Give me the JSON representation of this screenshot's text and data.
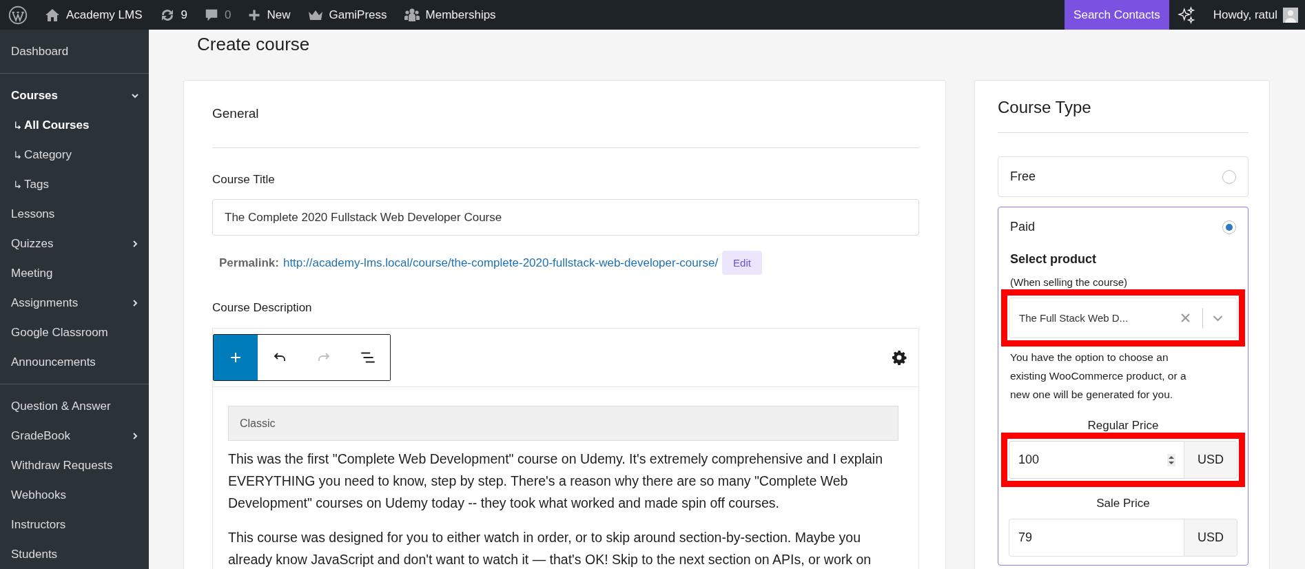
{
  "admin_bar": {
    "items": [
      {
        "kind": "wordpress"
      },
      {
        "kind": "site",
        "label": "Academy LMS"
      },
      {
        "kind": "updates",
        "label": "9"
      },
      {
        "kind": "comments",
        "label": "0"
      },
      {
        "kind": "new",
        "label": "New"
      },
      {
        "kind": "gamipress",
        "label": "GamiPress"
      },
      {
        "kind": "memberships",
        "label": "Memberships"
      }
    ],
    "search_contacts": "Search Contacts",
    "greeting": "Howdy, ratul"
  },
  "sidebar": {
    "groups": [
      {
        "items": [
          {
            "label": "Dashboard",
            "current": false,
            "kind": "link"
          }
        ]
      },
      {
        "items": [
          {
            "label": "Courses",
            "current": true,
            "kind": "open",
            "children": [
              {
                "label": "All Courses",
                "current": true
              },
              {
                "label": "Category",
                "current": false
              },
              {
                "label": "Tags",
                "current": false
              }
            ]
          },
          {
            "label": "Lessons",
            "current": false,
            "kind": "link"
          },
          {
            "label": "Quizzes",
            "current": false,
            "kind": "closed"
          },
          {
            "label": "Meeting",
            "current": false,
            "kind": "link"
          },
          {
            "label": "Assignments",
            "current": false,
            "kind": "closed"
          },
          {
            "label": "Google Classroom",
            "current": false,
            "kind": "link"
          },
          {
            "label": "Announcements",
            "current": false,
            "kind": "link"
          }
        ]
      },
      {
        "items": [
          {
            "label": "Question & Answer",
            "current": false,
            "kind": "link"
          },
          {
            "label": "GradeBook",
            "current": false,
            "kind": "closed"
          },
          {
            "label": "Withdraw Requests",
            "current": false,
            "kind": "link"
          },
          {
            "label": "Webhooks",
            "current": false,
            "kind": "link"
          },
          {
            "label": "Instructors",
            "current": false,
            "kind": "link"
          },
          {
            "label": "Students",
            "current": false,
            "kind": "link"
          }
        ]
      }
    ]
  },
  "page_title": "Create course",
  "general": {
    "heading": "General",
    "title_label": "Course Title",
    "title_value": "The Complete 2020 Fullstack Web Developer Course",
    "permalink_label": "Permalink:",
    "permalink_url": "http://academy-lms.local/course/the-complete-2020-fullstack-web-developer-course/",
    "edit_button": "Edit",
    "description_label": "Course Description",
    "toolbar": [
      {
        "kind": "add",
        "active": true,
        "disabled": false
      },
      {
        "kind": "undo",
        "active": false,
        "disabled": false
      },
      {
        "kind": "redo",
        "active": false,
        "disabled": true
      },
      {
        "kind": "outline",
        "active": false,
        "disabled": false
      }
    ],
    "classic_label": "Classic",
    "paragraphs": [
      "This was the first \"Complete Web Development\" course on Udemy. It's extremely comprehensive and I explain EVERYTHING you need to know, step by step. There's a reason why there are so many \"Complete Web Development\" courses on Udemy today -- they took what worked and made spin off courses.",
      "This course was designed for you to either watch in order, or to skip around section-by-section. Maybe you already know JavaScript and don't want to watch it — that's OK! Skip to the next section on APIs, or work on"
    ]
  },
  "course_type": {
    "title": "Course Type",
    "options": [
      {
        "label": "Free",
        "selected": false
      },
      {
        "label": "Paid",
        "selected": true
      }
    ],
    "product": {
      "label": "Select product",
      "hint": "(When selling the course)",
      "value": "The Full Stack Web D...",
      "highlighted": true,
      "help": "You have the option to choose an existing WooCommerce product, or a new one will be generated for you."
    },
    "prices": [
      {
        "label": "Regular Price",
        "value": "100",
        "currency": "USD",
        "highlighted": true,
        "focused": true
      },
      {
        "label": "Sale Price",
        "value": "79",
        "currency": "USD",
        "highlighted": false,
        "focused": false
      }
    ]
  }
}
